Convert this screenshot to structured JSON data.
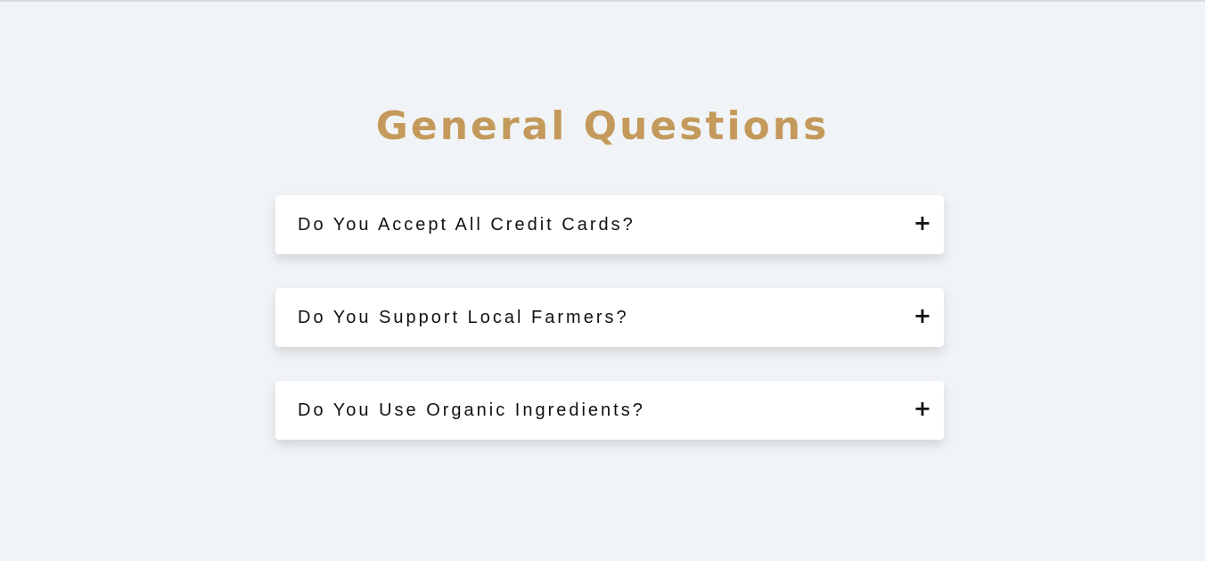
{
  "faq": {
    "title": "General Questions",
    "items": [
      {
        "question": "Do You Accept All Credit Cards?",
        "toggle": "+"
      },
      {
        "question": "Do You Support Local Farmers?",
        "toggle": "+"
      },
      {
        "question": "Do You Use Organic Ingredients?",
        "toggle": "+"
      }
    ]
  },
  "colors": {
    "background": "#f1f4f7",
    "title": "#c49a5c",
    "card": "#ffffff",
    "text": "#111111"
  },
  "icons": {
    "toggle": "plus-icon"
  }
}
